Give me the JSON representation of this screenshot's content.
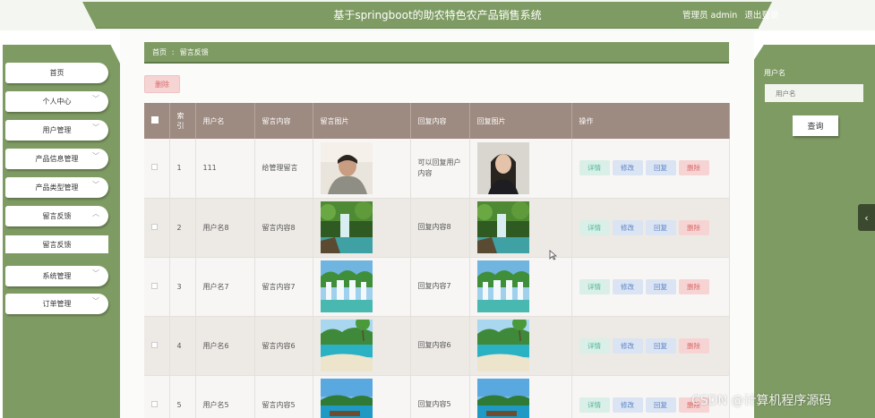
{
  "header": {
    "title": "基于springboot的助农特色农产品销售系统",
    "admin_label": "管理员 admin",
    "logout_label": "退出登录"
  },
  "sidebar": {
    "items": [
      {
        "label": "首页"
      },
      {
        "label": "个人中心"
      },
      {
        "label": "用户管理"
      },
      {
        "label": "产品信息管理"
      },
      {
        "label": "产品类型管理"
      },
      {
        "label": "留言反馈"
      },
      {
        "label": "系统管理"
      },
      {
        "label": "订单管理"
      }
    ],
    "submenu": {
      "label": "留言反馈"
    }
  },
  "breadcrumb": {
    "home": "首页",
    "separator": "ː",
    "current": "留言反馈"
  },
  "toolbar": {
    "delete_label": "删除"
  },
  "table": {
    "columns": [
      "索引",
      "用户名",
      "留言内容",
      "留言图片",
      "回复内容",
      "回复图片",
      "操作"
    ],
    "index_col_label": "索\n引",
    "actions": {
      "detail": "详情",
      "edit": "修改",
      "reply": "回复",
      "delete": "删除"
    },
    "rows": [
      {
        "index": "1",
        "username": "111",
        "message": "给管理留言",
        "reply": "可以回复用户内容",
        "msg_img": "portrait-man",
        "reply_img": "portrait-woman"
      },
      {
        "index": "2",
        "username": "用户名8",
        "message": "留言内容8",
        "reply": "回复内容8",
        "msg_img": "waterfall-forest",
        "reply_img": "waterfall-forest"
      },
      {
        "index": "3",
        "username": "用户名7",
        "message": "留言内容7",
        "reply": "回复内容7",
        "msg_img": "waterfall-cascade",
        "reply_img": "waterfall-cascade"
      },
      {
        "index": "4",
        "username": "用户名6",
        "message": "留言内容6",
        "reply": "回复内容6",
        "msg_img": "tropical-beach",
        "reply_img": "tropical-beach"
      },
      {
        "index": "5",
        "username": "用户名5",
        "message": "留言内容5",
        "reply": "回复内容5",
        "msg_img": "island-dock",
        "reply_img": "island-dock"
      }
    ]
  },
  "search": {
    "label": "用户名",
    "placeholder": "用户名",
    "button_label": "查询"
  },
  "side_toggle": {
    "icon": "chevron-left-icon"
  },
  "watermark": "CSDN @计算机程序源码",
  "colors": {
    "accent": "#7e9b63",
    "table_header": "#9d8a80",
    "danger": "#d96a6a",
    "info": "#5d85c8",
    "success": "#4fb59a"
  }
}
